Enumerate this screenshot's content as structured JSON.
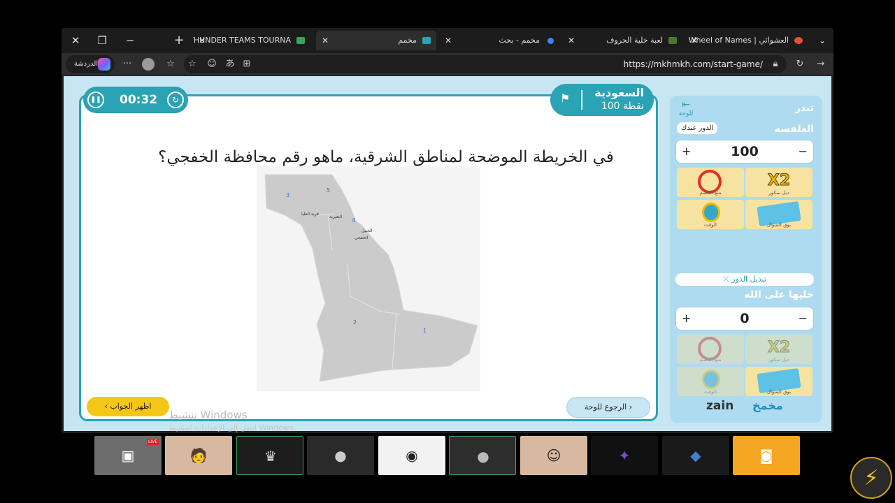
{
  "browser": {
    "tabs": [
      {
        "title": "Wheel of Names | العشوائي",
        "favicon_color": "#e0533b"
      },
      {
        "title": "لعبة خلية الحروف",
        "favicon_color": "#4a7a2c"
      },
      {
        "title": "مخمم - بحث",
        "favicon_color": "#3b82f6"
      },
      {
        "title": "مخمم",
        "favicon_color": "#2aa3b4"
      },
      {
        "title": "THUNDER TEAMS TOURNA",
        "favicon_color": "#3aa35b"
      }
    ],
    "copilot_label": "الدردشة",
    "url": "https://mkhmkh.com/start-game/"
  },
  "game": {
    "timer": "00:32",
    "current_team": {
      "name": "السعودية",
      "points": "100 نقطة"
    },
    "question": "في الخريطة الموضحة لمناطق الشرقية، ماهو رقم محافظة الخفجي؟",
    "map_labels": [
      {
        "text": "3"
      },
      {
        "text": "5"
      },
      {
        "text": "4"
      },
      {
        "text": "2"
      },
      {
        "text": "1"
      },
      {
        "text": "قرية العليا"
      },
      {
        "text": "النعيرية"
      },
      {
        "text": "الجبيل"
      },
      {
        "text": "الخفجي"
      }
    ],
    "show_answer_label": "اظهر الجواب",
    "back_to_board_label": "الرجوع للوحة",
    "watermark_title": "تنشيط Windows",
    "watermark_sub": "انتقل إلى الإعدادات لتنشيط Windows."
  },
  "sidebar": {
    "game_title": "ثندر",
    "to_board_label": "للوحة",
    "team1": {
      "name": "العلفسه",
      "turn_label": "الدور عندك",
      "score": "100"
    },
    "team2": {
      "name": "خليها على الله",
      "score": "0"
    },
    "switch_turn_label": "تبديل الدور",
    "powerups": [
      {
        "name": "x2",
        "text": "X2",
        "caption": "دبل سكور"
      },
      {
        "name": "block",
        "caption": "منع الخصم"
      },
      {
        "name": "cards",
        "caption": "بوق السؤال"
      },
      {
        "name": "timer",
        "caption": "الوقت"
      }
    ],
    "logos": {
      "zain": "zain",
      "brand": "مخمخ"
    }
  },
  "taskbar": {
    "live_label": "LIVE"
  }
}
